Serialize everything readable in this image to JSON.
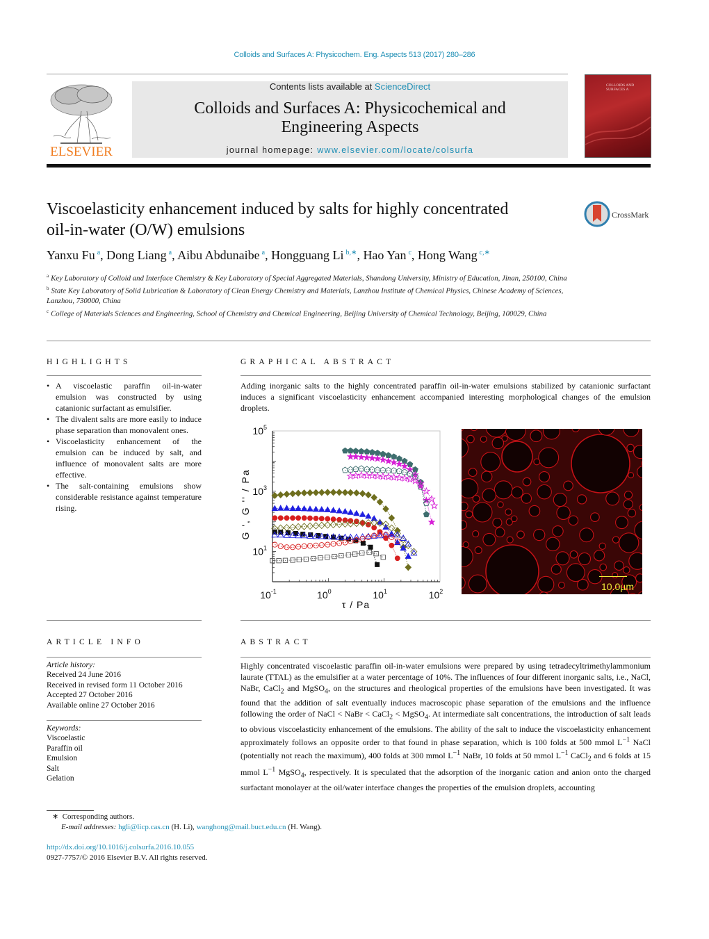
{
  "header": {
    "citation": "Colloids and Surfaces A: Physicochem. Eng. Aspects 513 (2017) 280–286",
    "contents_prefix": "Contents lists available at ",
    "contents_link": "ScienceDirect",
    "journal_title_line1": "Colloids and Surfaces A: Physicochemical and",
    "journal_title_line2": "Engineering Aspects",
    "homepage_prefix": "journal homepage: ",
    "homepage_link": "www.elsevier.com/locate/colsurfa",
    "publisher_logo_text": "ELSEVIER",
    "publisher_color": "#f07c1f",
    "link_color": "#1f8fb5",
    "cover_text": "COLLOIDS AND SURFACES A"
  },
  "article": {
    "title_line1": "Viscoelasticity enhancement induced by salts for highly concentrated",
    "title_line2": "oil-in-water (O/W) emulsions",
    "crossmark_label": "CrossMark",
    "authors": [
      {
        "name": "Yanxu Fu",
        "sup": "a"
      },
      {
        "name": "Dong Liang",
        "sup": "a"
      },
      {
        "name": "Aibu Abdunaibe",
        "sup": "a"
      },
      {
        "name": "Hongguang Li",
        "sup": "b,∗"
      },
      {
        "name": "Hao Yan",
        "sup": "c"
      },
      {
        "name": "Hong Wang",
        "sup": "c,∗"
      }
    ],
    "affiliations": [
      {
        "sup": "a",
        "text": "Key Laboratory of Colloid and Interface Chemistry & Key Laboratory of Special Aggregated Materials, Shandong University, Ministry of Education, Jinan, 250100, China"
      },
      {
        "sup": "b",
        "text": "State Key Laboratory of Solid Lubrication & Laboratory of Clean Energy Chemistry and Materials, Lanzhou Institute of Chemical Physics, Chinese Academy of Sciences, Lanzhou, 730000, China"
      },
      {
        "sup": "c",
        "text": "College of Materials Sciences and Engineering, School of Chemistry and Chemical Engineering, Beijing University of Chemical Technology, Beijing, 100029, China"
      }
    ]
  },
  "highlights": {
    "heading": "HIGHLIGHTS",
    "items": [
      "A viscoelastic paraffin oil-in-water emulsion was constructed by using catanionic surfactant as emulsifier.",
      "The divalent salts are more easily to induce phase separation than monovalent ones.",
      "Viscoelasticity enhancement of the emulsion can be induced by salt, and influence of monovalent salts are more effective.",
      "The salt-containing emulsions show considerable resistance against temperature rising."
    ]
  },
  "graphical_abstract": {
    "heading": "GRAPHICAL ABSTRACT",
    "text": "Adding inorganic salts to the highly concentrated paraffin oil-in-water emulsions stabilized by catanionic surfactant induces a significant viscoelasticity enhancement accompanied interesting morphological changes of the emulsion droplets.",
    "micrograph_scale_label": "10.0µm"
  },
  "chart_data": {
    "type": "scatter",
    "title": "",
    "xlabel": "τ / Pa",
    "ylabel": "G ', G '' / Pa",
    "xscale": "log",
    "yscale": "log",
    "xlim": [
      0.1,
      100
    ],
    "ylim": [
      1,
      100000
    ],
    "xticks": [
      {
        "value": 0.1,
        "base": "10",
        "exp": "-1"
      },
      {
        "value": 1,
        "base": "10",
        "exp": "0"
      },
      {
        "value": 10,
        "base": "10",
        "exp": "1"
      },
      {
        "value": 100,
        "base": "10",
        "exp": "2"
      }
    ],
    "yticks": [
      {
        "value": 10,
        "base": "10",
        "exp": "1"
      },
      {
        "value": 1000,
        "base": "10",
        "exp": "3"
      },
      {
        "value": 100000,
        "base": "10",
        "exp": "5"
      }
    ],
    "grid": false,
    "legend": "none",
    "series": [
      {
        "name": "G' (pentagon, filled)",
        "marker": "pentagon",
        "filled": true,
        "color": "#3e6e6e",
        "x": [
          2.0,
          2.5,
          3.1,
          3.9,
          4.9,
          6.1,
          7.6,
          9.5,
          11.9,
          14.9,
          18.6,
          23.2,
          29,
          36,
          45,
          57
        ],
        "y": [
          22000,
          22000,
          21500,
          21000,
          20500,
          19500,
          18500,
          17000,
          15500,
          14000,
          12000,
          10000,
          7800,
          5200,
          2000,
          170
        ]
      },
      {
        "name": "G' (star, filled)",
        "marker": "star",
        "filled": true,
        "color": "#d61fd6",
        "x": [
          2.5,
          3.1,
          3.9,
          4.9,
          6.1,
          7.6,
          9.5,
          11.9,
          14.9,
          18.6,
          23.2,
          29,
          36,
          45,
          57,
          71
        ],
        "y": [
          14000,
          14000,
          13500,
          13000,
          12500,
          12000,
          11000,
          10000,
          9000,
          8000,
          6800,
          5200,
          3500,
          1500,
          500,
          95
        ]
      },
      {
        "name": "G'' (pentagon, open)",
        "marker": "pentagon",
        "filled": false,
        "color": "#3e6e6e",
        "x": [
          2.0,
          2.5,
          3.1,
          3.9,
          4.9,
          6.1,
          7.6,
          9.5,
          11.9,
          14.9,
          18.6,
          23.2,
          29,
          36,
          45,
          57
        ],
        "y": [
          5000,
          5200,
          5400,
          5600,
          5300,
          5200,
          5100,
          5000,
          4900,
          4800,
          4600,
          4300,
          3800,
          3000,
          1400,
          400
        ]
      },
      {
        "name": "G'' (star, open)",
        "marker": "star",
        "filled": false,
        "color": "#d61fd6",
        "x": [
          2.5,
          3.1,
          3.9,
          4.9,
          6.1,
          7.6,
          9.5,
          11.9,
          14.9,
          18.6,
          23.2,
          29,
          36,
          45,
          57,
          71,
          79
        ],
        "y": [
          3200,
          3300,
          3400,
          3300,
          3300,
          3200,
          3100,
          3000,
          2900,
          2800,
          2700,
          2500,
          2200,
          1800,
          1000,
          550,
          330
        ]
      },
      {
        "name": "G' (diamond, filled)",
        "marker": "diamond",
        "filled": true,
        "color": "#6e6e1e",
        "x": [
          0.11,
          0.14,
          0.18,
          0.23,
          0.29,
          0.37,
          0.47,
          0.6,
          0.76,
          0.97,
          1.23,
          1.57,
          2.0,
          2.5,
          3.2,
          4.1,
          5.2,
          6.6,
          8.4,
          10.7,
          13.6,
          17.3,
          22,
          27
        ],
        "y": [
          720,
          760,
          800,
          830,
          860,
          880,
          890,
          900,
          910,
          920,
          920,
          920,
          910,
          900,
          880,
          840,
          760,
          620,
          440,
          260,
          130,
          50,
          14,
          3
        ]
      },
      {
        "name": "G' (triangle, filled)",
        "marker": "triangle",
        "filled": true,
        "color": "#1f1fe0",
        "x": [
          0.11,
          0.14,
          0.18,
          0.23,
          0.29,
          0.37,
          0.47,
          0.6,
          0.76,
          0.97,
          1.23,
          1.57,
          2.0,
          2.5,
          3.2,
          4.1,
          5.2,
          6.6,
          8.4,
          10.7,
          13.6,
          17.3,
          22,
          27
        ],
        "y": [
          270,
          275,
          275,
          270,
          270,
          265,
          260,
          255,
          250,
          245,
          235,
          225,
          215,
          200,
          185,
          170,
          150,
          125,
          95,
          65,
          38,
          20,
          13,
          7
        ]
      },
      {
        "name": "G' (circle, filled)",
        "marker": "circle",
        "filled": true,
        "color": "#d81f1f",
        "x": [
          0.11,
          0.14,
          0.18,
          0.23,
          0.29,
          0.37,
          0.47,
          0.6,
          0.76,
          0.97,
          1.23,
          1.57,
          2.0,
          2.5,
          3.2,
          4.1,
          5.2,
          6.6,
          8.4,
          10.7,
          13.6,
          17.3
        ],
        "y": [
          130,
          130,
          130,
          130,
          130,
          130,
          128,
          126,
          124,
          122,
          118,
          114,
          110,
          105,
          100,
          90,
          78,
          62,
          45,
          28,
          16,
          6
        ]
      },
      {
        "name": "G'' (diamond, open)",
        "marker": "diamond",
        "filled": false,
        "color": "#6e6e1e",
        "x": [
          0.11,
          0.14,
          0.18,
          0.23,
          0.29,
          0.37,
          0.47,
          0.6,
          0.76,
          0.97,
          1.23,
          1.57,
          2.0,
          2.5,
          3.2,
          4.1,
          5.2,
          6.6,
          8.4,
          10.7,
          13.6,
          17.3,
          22,
          27,
          34
        ],
        "y": [
          58,
          60,
          62,
          64,
          66,
          68,
          70,
          72,
          74,
          76,
          78,
          80,
          82,
          84,
          86,
          88,
          90,
          90,
          88,
          80,
          60,
          40,
          25,
          16,
          10
        ]
      },
      {
        "name": "G' (square, filled)",
        "marker": "square",
        "filled": true,
        "color": "#111111",
        "x": [
          0.11,
          0.14,
          0.19,
          0.26,
          0.35,
          0.48,
          0.66,
          0.9,
          1.23,
          1.7,
          2.3,
          3.1,
          4.2,
          5.7,
          7.5
        ],
        "y": [
          45,
          44,
          42,
          40,
          38,
          36,
          34,
          32,
          30,
          28,
          26,
          23,
          19,
          14,
          3.7
        ]
      },
      {
        "name": "G'' (triangle, open)",
        "marker": "triangle",
        "filled": false,
        "color": "#1f1fe0",
        "x": [
          0.11,
          0.14,
          0.18,
          0.23,
          0.29,
          0.37,
          0.47,
          0.6,
          0.76,
          0.97,
          1.23,
          1.57,
          2.0,
          2.5,
          3.2,
          4.1,
          5.2,
          6.6,
          8.4,
          10.7,
          13.6,
          17.3,
          22,
          27,
          34
        ],
        "y": [
          36,
          36,
          35,
          35,
          34,
          34,
          33,
          32,
          32,
          31,
          31,
          30,
          30,
          30,
          30,
          31,
          32,
          33,
          34,
          36,
          38,
          36,
          28,
          18,
          9
        ]
      },
      {
        "name": "G'' (circle, open)",
        "marker": "circle",
        "filled": false,
        "color": "#d81f1f",
        "x": [
          0.11,
          0.14,
          0.18,
          0.23,
          0.29,
          0.37,
          0.47,
          0.6,
          0.76,
          0.97,
          1.23,
          1.57,
          2.0,
          2.5,
          3.2,
          4.1,
          5.2,
          6.6,
          8.4,
          10.7,
          13.6,
          17.3
        ],
        "y": [
          17,
          15,
          14,
          14,
          14.5,
          15,
          15.5,
          16,
          16.5,
          17,
          18,
          19,
          20,
          22,
          24,
          27,
          30,
          34,
          37,
          36,
          30,
          22
        ]
      },
      {
        "name": "G'' (square, open)",
        "marker": "square",
        "filled": false,
        "color": "#555555",
        "x": [
          0.1,
          0.13,
          0.17,
          0.23,
          0.3,
          0.4,
          0.54,
          0.72,
          0.96,
          1.28,
          1.7,
          2.3,
          3.0,
          4.0,
          5.4,
          7.2,
          9.6
        ],
        "y": [
          5.0,
          5.0,
          5.1,
          5.2,
          5.4,
          5.6,
          5.9,
          6.2,
          6.5,
          6.9,
          7.3,
          7.8,
          8.3,
          8.9,
          9.5,
          8.5,
          6.5
        ]
      }
    ]
  },
  "article_info": {
    "heading": "ARTICLE INFO",
    "history_label": "Article history:",
    "history": [
      "Received 24 June 2016",
      "Received in revised form 11 October 2016",
      "Accepted 27 October 2016",
      "Available online 27 October 2016"
    ],
    "keywords_label": "Keywords:",
    "keywords": [
      "Viscoelastic",
      "Paraffin oil",
      "Emulsion",
      "Salt",
      "Gelation"
    ]
  },
  "abstract": {
    "heading": "ABSTRACT",
    "p1": "Highly concentrated viscoelastic paraffin oil-in-water emulsions were prepared by using tetradecyltrimethylammonium laurate (TTAL) as the emulsifier at a water percentage of 10%. The influences of four different inorganic salts, i.e., NaCl, NaBr, CaCl",
    "p2": " and MgSO",
    "p3": ", on the structures and rheological properties of the emulsions have been investigated. It was found that the addition of salt eventually induces macroscopic phase separation of the emulsions and the influence following the order of NaCl < NaBr < CaCl",
    "p4": " < MgSO",
    "p5": ". At intermediate salt concentrations, the introduction of salt leads to obvious viscoelasticity enhancement of the emulsions. The ability of the salt to induce the viscoelasticity enhancement approximately follows an opposite order to that found in phase separation, which is 100 folds at 500 mmol L",
    "p6": " NaCl (potentially not reach the maximum), 400 folds at 300 mmol L",
    "p7": " NaBr, 10 folds at 50 mmol L",
    "p8": " CaCl",
    "p9": " and 6 folds at 15 mmol L",
    "p10": " MgSO",
    "p11": ", respectively. It is speculated that the adsorption of the inorganic cation and anion onto the charged surfactant monolayer at the oil/water interface changes the properties of the emulsion droplets, accounting",
    "sub2": "2",
    "sub4": "4",
    "supm1": "−1"
  },
  "footer": {
    "corresponding_mark": "∗",
    "corresponding": "Corresponding authors.",
    "email_label": "E-mail addresses:",
    "email1": "hgli@licp.cas.cn",
    "email1_who": " (H. Li), ",
    "email2": "wanghong@mail.buct.edu.cn",
    "email2_who": " (H. Wang).",
    "doi": "http://dx.doi.org/10.1016/j.colsurfa.2016.10.055",
    "copyright": "0927-7757/© 2016 Elsevier B.V. All rights reserved."
  }
}
